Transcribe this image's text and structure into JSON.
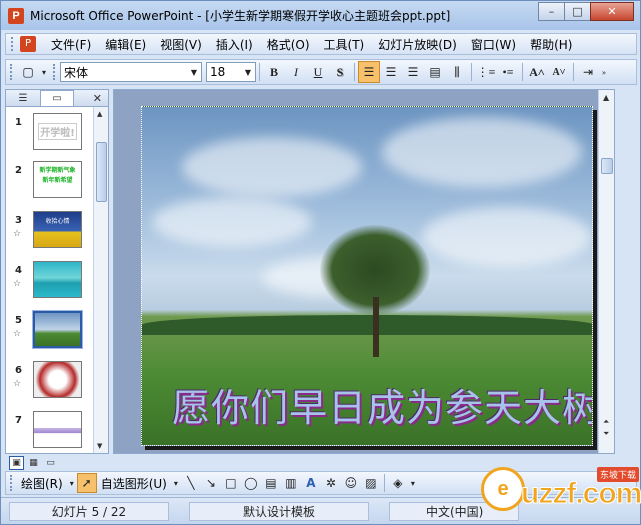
{
  "window": {
    "title": "Microsoft Office PowerPoint - [小学生新学期寒假开学收心主题班会ppt.ppt]",
    "minimize_glyph": "–",
    "maximize_glyph": "□",
    "close_glyph": "✕"
  },
  "menu": {
    "items": [
      "文件(F)",
      "编辑(E)",
      "视图(V)",
      "插入(I)",
      "格式(O)",
      "工具(T)",
      "幻灯片放映(D)",
      "窗口(W)",
      "帮助(H)"
    ]
  },
  "format_toolbar": {
    "font_name": "宋体",
    "font_size": "18",
    "bold": "B",
    "italic": "I",
    "underline": "U",
    "shadow": "S"
  },
  "left_pane": {
    "tab_outline_icon": "outline-icon",
    "tab_slides_icon": "slides-icon",
    "close_glyph": "✕",
    "slides": [
      {
        "num": "1",
        "thumb_text": "开学啦!",
        "has_animation": false
      },
      {
        "num": "2",
        "thumb_text": "新学期新气象 新年新希望",
        "has_animation": false
      },
      {
        "num": "3",
        "thumb_text": "收拾心情",
        "has_animation": true
      },
      {
        "num": "4",
        "thumb_text": "",
        "has_animation": true
      },
      {
        "num": "5",
        "thumb_text": "",
        "has_animation": true,
        "selected": true
      },
      {
        "num": "6",
        "thumb_text": "",
        "has_animation": true
      },
      {
        "num": "7",
        "thumb_text": "",
        "has_animation": false
      }
    ]
  },
  "slide": {
    "caption": "愿你们早日成为参天大树!"
  },
  "draw_toolbar": {
    "draw_label": "绘图(R)",
    "autoshapes_label": "自选图形(U)"
  },
  "status": {
    "slide_position": "幻灯片 5 / 22",
    "template": "默认设计模板",
    "language": "中文(中国)"
  },
  "watermark": {
    "text": "uzzf.com",
    "sub": "东坡下载"
  },
  "colors": {
    "accent_orange": "#f6c16a",
    "window_blue": "#d7e4f5",
    "caption_fill": "#a7c3ea",
    "caption_outline": "#8a2a8a"
  }
}
